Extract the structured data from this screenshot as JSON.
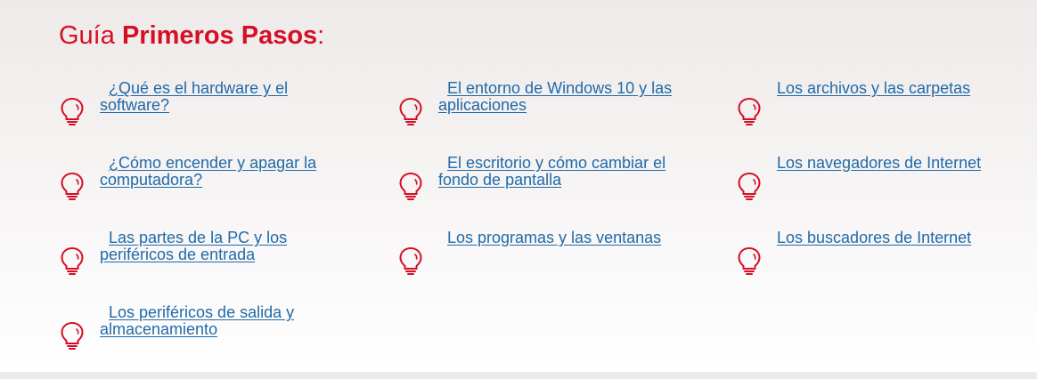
{
  "page": {
    "title_light": "Guía ",
    "title_bold": "Primeros Pasos",
    "title_colon": ":"
  },
  "colors": {
    "accent": "#d50f25",
    "link": "#1f6aa8"
  },
  "guide": {
    "icon": "lightbulb-icon",
    "links": [
      {
        "label": "¿Qué es el hardware y el software?"
      },
      {
        "label": "El entorno de Windows 10 y las aplicaciones"
      },
      {
        "label": "Los archivos y las carpetas"
      },
      {
        "label": "¿Cómo encender y apagar la computadora?"
      },
      {
        "label": "El escritorio y cómo cambiar el fondo de pantalla"
      },
      {
        "label": "Los navegadores de Internet"
      },
      {
        "label": "Las partes de la PC y los periféricos de entrada"
      },
      {
        "label": "Los programas y las ventanas"
      },
      {
        "label": "Los buscadores de Internet"
      },
      {
        "label": "Los periféricos de salida y almacenamiento"
      }
    ]
  }
}
